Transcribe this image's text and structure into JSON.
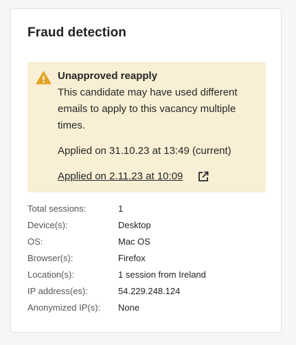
{
  "panel": {
    "title": "Fraud detection"
  },
  "alert": {
    "icon": "warning-icon",
    "icon_color": "#e0a526",
    "background_color": "#f8efd4",
    "title": "Unapproved reapply",
    "message": "This candidate may have used different emails to apply to this vacancy multiple times.",
    "current_application": "Applied on 31.10.23 at 13:49 (current)",
    "other_application_link": "Applied on 2.11.23 at 10:09",
    "link_icon": "external-link-icon"
  },
  "details": {
    "rows": [
      {
        "label": "Total sessions:",
        "value": "1"
      },
      {
        "label": "Device(s):",
        "value": "Desktop"
      },
      {
        "label": "OS:",
        "value": "Mac OS"
      },
      {
        "label": "Browser(s):",
        "value": "Firefox"
      },
      {
        "label": "Location(s):",
        "value": "1 session from Ireland"
      },
      {
        "label": "IP address(es):",
        "value": "54.229.248.124"
      },
      {
        "label": "Anonymized IP(s):",
        "value": "None"
      }
    ]
  }
}
